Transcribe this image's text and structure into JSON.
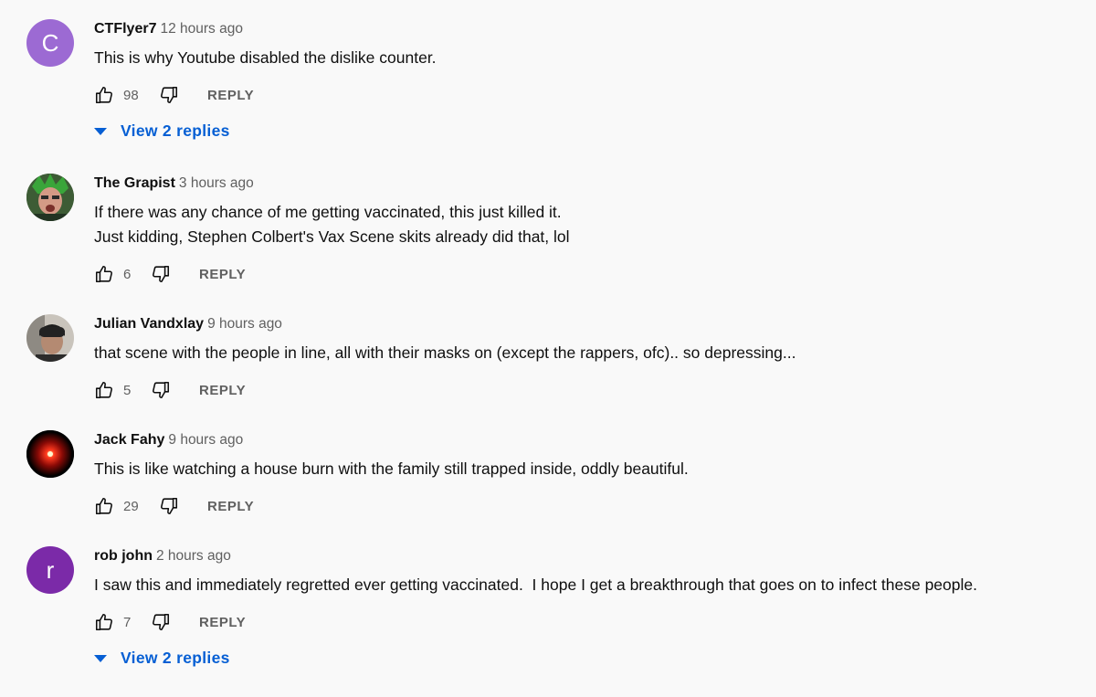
{
  "colors": {
    "link": "#065fd4",
    "meta": "#606060",
    "text": "#0f0f0f",
    "background": "#f9f9f9"
  },
  "comments": [
    {
      "author": "CTFlyer7",
      "time": "12 hours ago",
      "avatar": {
        "type": "letter",
        "letter": "C",
        "color": "#9c6ad3"
      },
      "lines": [
        "This is why Youtube disabled the dislike counter."
      ],
      "likes": "98",
      "reply_label": "REPLY",
      "view_replies": "View 2 replies"
    },
    {
      "author": "The Grapist",
      "time": "3 hours ago",
      "avatar": {
        "type": "image",
        "icon": "profile-photo-icon"
      },
      "lines": [
        "If there was any chance of me getting vaccinated, this just killed it.",
        "Just kidding, Stephen Colbert's Vax Scene skits already did that, lol"
      ],
      "likes": "6",
      "reply_label": "REPLY"
    },
    {
      "author": "Julian Vandxlay",
      "time": "9 hours ago",
      "avatar": {
        "type": "image",
        "icon": "profile-photo-icon"
      },
      "lines": [
        "that scene with the people in line, all with their masks on (except the rappers, ofc).. so depressing..."
      ],
      "likes": "5",
      "reply_label": "REPLY"
    },
    {
      "author": "Jack Fahy",
      "time": "9 hours ago",
      "avatar": {
        "type": "image",
        "icon": "hal-eye-icon"
      },
      "lines": [
        "This is like watching a house burn with the family still trapped inside, oddly beautiful."
      ],
      "likes": "29",
      "reply_label": "REPLY"
    },
    {
      "author": "rob john",
      "time": "2 hours ago",
      "avatar": {
        "type": "letter",
        "letter": "r",
        "color": "#7b2aa8"
      },
      "lines": [
        "I saw this and immediately regretted ever getting vaccinated.  I hope I get a breakthrough that goes on to infect these people."
      ],
      "likes": "7",
      "reply_label": "REPLY",
      "view_replies": "View 2 replies"
    }
  ]
}
